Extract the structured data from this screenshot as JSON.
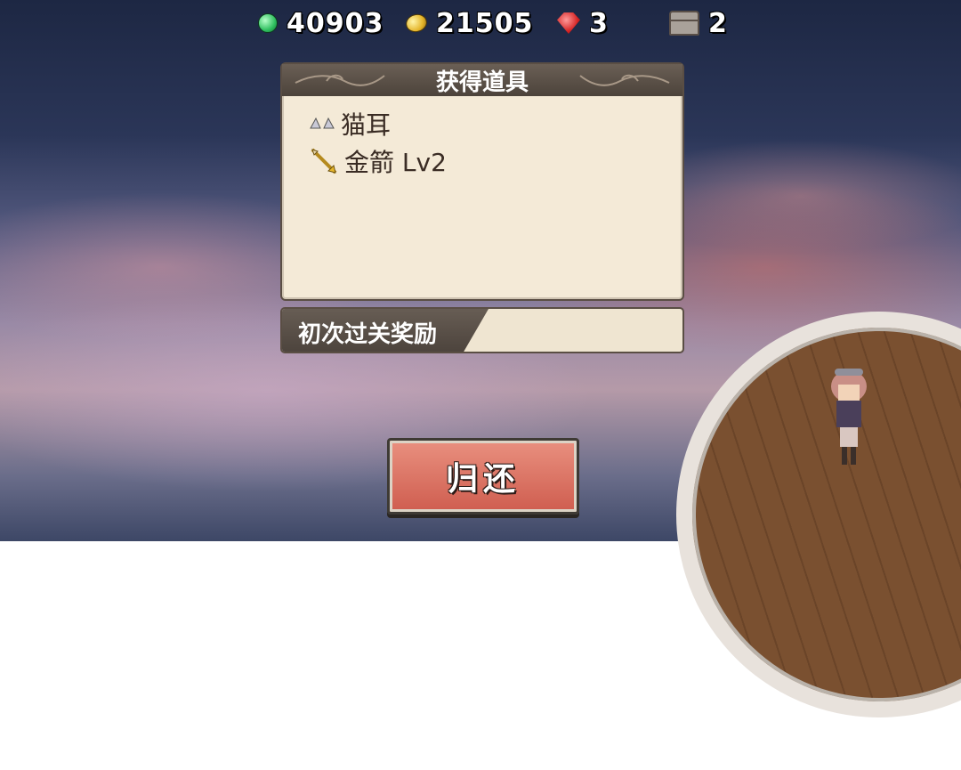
{
  "hud": {
    "green_gems": "40903",
    "gold_coins": "21505",
    "rubies": "3",
    "chests": "2"
  },
  "dialog": {
    "title": "获得道具",
    "items": [
      {
        "label": "猫耳",
        "icon": "cat-ear-icon"
      },
      {
        "label": "金箭 Lv2",
        "icon": "gold-arrow-icon"
      }
    ]
  },
  "reward_banner": {
    "label": "初次过关奖励"
  },
  "return_button": {
    "label": "归还"
  }
}
